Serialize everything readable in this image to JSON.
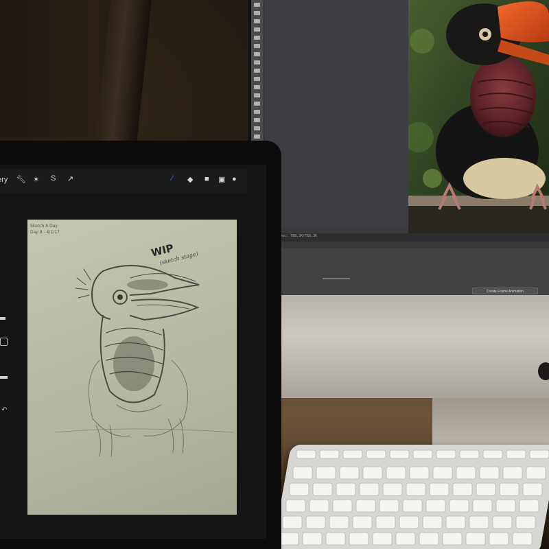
{
  "procreate": {
    "gallery_label": "ery",
    "icons": [
      "wrench-icon",
      "magic-wand-icon",
      "selection-icon",
      "move-icon",
      "brush-icon",
      "smudge-icon",
      "eraser-icon",
      "layers-icon",
      "color-icon"
    ]
  },
  "drawing": {
    "title": "Sketch A Day",
    "day_line": "Day 9 - 4/1/17",
    "wip_label": "WIP",
    "wip_note": "(sketch stage)"
  },
  "photoshop": {
    "status_text": "Doc: 788,3K/788,3K",
    "timeline_button": "Create Frame Animation"
  },
  "colors": {
    "paper": "#b8baa4",
    "procreate_accent": "#3e7fe0",
    "ps_background": "#3a3a3c",
    "bird_casque": "#e0531c"
  }
}
